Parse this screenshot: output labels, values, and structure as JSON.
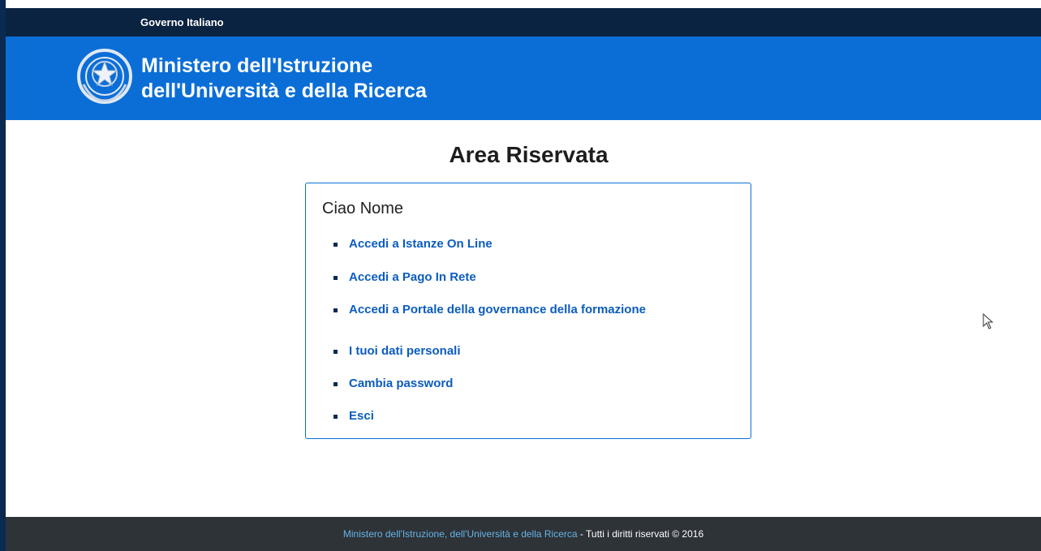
{
  "gov_bar": {
    "label": "Governo Italiano"
  },
  "header": {
    "emblem_icon": "italian-republic-emblem-icon",
    "title_line1": "Ministero dell'Istruzione",
    "title_line2": "dell'Università e della Ricerca"
  },
  "main": {
    "page_title": "Area Riservata",
    "greeting": "Ciao Nome",
    "links": [
      {
        "label": "Accedi a Istanze On Line"
      },
      {
        "label": "Accedi a Pago In Rete"
      },
      {
        "label": "Accedi a Portale della governance della formazione"
      },
      {
        "label": "I tuoi dati personali"
      },
      {
        "label": "Cambia password"
      },
      {
        "label": "Esci"
      }
    ]
  },
  "footer": {
    "ministry_link": "Ministero dell'Istruzione, dell'Università e della Ricerca",
    "rights": " - Tutti i diritti riservati © 2016"
  },
  "colors": {
    "gov_bar": "#0a2341",
    "header": "#0b6ed7",
    "link": "#0b5cc0",
    "footer": "#2e3338",
    "footer_link": "#66b3e6"
  }
}
